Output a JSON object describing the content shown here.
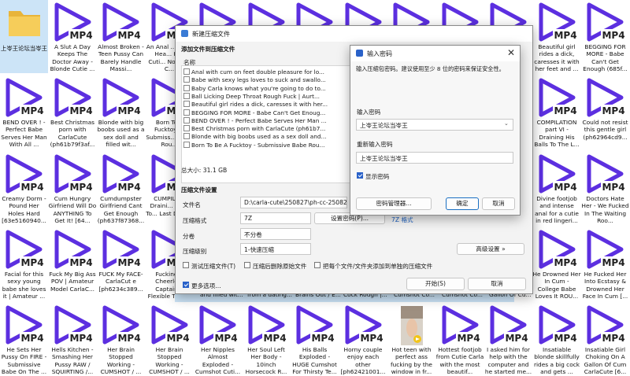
{
  "grid": {
    "tiles": [
      {
        "kind": "folder",
        "label": "上岺王论坛当岺王",
        "selected": true
      },
      {
        "kind": "mp4",
        "label": "A Slut A Day Keeps The Doctor Away - Blonde Cutie ..."
      },
      {
        "kind": "mp4",
        "label": "Almost Broken - Teen Pussy Can Barely Handle Massi..."
      },
      {
        "kind": "mp4",
        "label": "An Anal ... From Hea... Her Cuti... Not The C..."
      },
      {
        "kind": "mp4",
        "label": ""
      },
      {
        "kind": "mp4",
        "label": ""
      },
      {
        "kind": "mp4",
        "label": ""
      },
      {
        "kind": "mp4",
        "label": ""
      },
      {
        "kind": "mp4",
        "label": ""
      },
      {
        "kind": "mp4",
        "label": ""
      },
      {
        "kind": "mp4",
        "label": ""
      },
      {
        "kind": "mp4",
        "label": "Beautiful girl rides a dick, caresses it with her feet and ..."
      },
      {
        "kind": "mp4",
        "label": "BEGGING FOR MORE - Babe Can't Get Enough (685f..."
      },
      {
        "kind": "mp4",
        "label": "BEND OVER ! - Perfect Babe Serves Her Man With All ..."
      },
      {
        "kind": "mp4",
        "label": "Best Christmas porn with CarlaCute (ph61b79f3af..."
      },
      {
        "kind": "mp4",
        "label": "Blonde with big boobs used as a sex doll and filled wit..."
      },
      {
        "kind": "mp4",
        "label": "Born To... Fucktoy ... Submiss... Babe Rou..."
      },
      {
        "kind": "mp4",
        "label": ""
      },
      {
        "kind": "mp4",
        "label": ""
      },
      {
        "kind": "mp4",
        "label": ""
      },
      {
        "kind": "mp4",
        "label": ""
      },
      {
        "kind": "mp4",
        "label": ""
      },
      {
        "kind": "mp4",
        "label": ""
      },
      {
        "kind": "mp4",
        "label": ""
      },
      {
        "kind": "mp4",
        "label": "COMPILATION part VI - Draining His Balls To The L..."
      },
      {
        "kind": "mp4",
        "label": "Could not resist this gentle girl (ph62964cd9..."
      },
      {
        "kind": "mp4",
        "label": "Creamy Dorm - Pound Her Holes Hard [63e5160940..."
      },
      {
        "kind": "mp4",
        "label": "Cum Hungry Girfriend Will Do ANYTHING To Get It! [64..."
      },
      {
        "kind": "mp4",
        "label": "Cumdumpster Girlfriend Cant Get Enough (ph637f87368..."
      },
      {
        "kind": "mp4",
        "label": "CUMPILA... Draini... Balls To... Last Drop..."
      },
      {
        "kind": "mp4",
        "label": ""
      },
      {
        "kind": "mp4",
        "label": ""
      },
      {
        "kind": "mp4",
        "label": ""
      },
      {
        "kind": "mp4",
        "label": ""
      },
      {
        "kind": "mp4",
        "label": ""
      },
      {
        "kind": "mp4",
        "label": ""
      },
      {
        "kind": "mp4",
        "label": ""
      },
      {
        "kind": "mp4",
        "label": "Divine footjob and intense anal for a cutie in red lingeri..."
      },
      {
        "kind": "mp4",
        "label": "Doctors Hate Her - We Fucked In The Waiting Roo..."
      },
      {
        "kind": "mp4",
        "label": "Facial for this sexy young babe she loves it | Amateur ..."
      },
      {
        "kind": "mp4",
        "label": "Fuck My Big Ass POV | Amateur Model CarlaC..."
      },
      {
        "kind": "mp4",
        "label": "FUCK My FACE-CarlaCut e [ph6234c389..."
      },
      {
        "kind": "mp4",
        "label": "Fucking... Cheerle... Captain... Flexible Teen..."
      },
      {
        "kind": "mp4",
        "label": ""
      },
      {
        "kind": "mp4",
        "label": ""
      },
      {
        "kind": "mp4",
        "label": ""
      },
      {
        "kind": "mp4",
        "label": ""
      },
      {
        "kind": "mp4",
        "label": ""
      },
      {
        "kind": "mp4",
        "label": ""
      },
      {
        "kind": "mp4",
        "label": ""
      },
      {
        "kind": "mp4",
        "label": "He Drowned Her In Cum - College Babe Loves It ROU..."
      },
      {
        "kind": "mp4",
        "label": "He Fucked Her Into Ecstasy & Drowned Her Face In Cum [..."
      },
      {
        "kind": "mp4",
        "label": "He Sets Her Pussy On FIRE - Submissive Babe On The ..."
      },
      {
        "kind": "mp4",
        "label": "Hells Kitchen - Smashing Her Pussy RAW / SQUIRTING /..."
      },
      {
        "kind": "mp4",
        "label": "Her Brain Stopped Working - CUMSHOT / ..."
      },
      {
        "kind": "mp4",
        "label": "Her Brain Stopped Working - CUMSHOT / ..."
      },
      {
        "kind": "mp4",
        "label": "Her Nipples Almost Exploded - Cumshot Cuti..."
      },
      {
        "kind": "mp4",
        "label": "Her Soul Left Her Body - 10inch Horsecock R..."
      },
      {
        "kind": "mp4",
        "label": "His Balls Exploded - HUGE Cumshot For Thirsty Te..."
      },
      {
        "kind": "mp4",
        "label": "Horny couple enjoy each other [ph62421001..."
      },
      {
        "kind": "thumb",
        "label": "Hot teen with perfect ass fucking by the window in fr..."
      },
      {
        "kind": "mp4",
        "label": "Hottest footjob from Cutie Carla with the most beautif..."
      },
      {
        "kind": "mp4",
        "label": "I asked him for help with the computer and he started me..."
      },
      {
        "kind": "mp4",
        "label": "Insatiable blonde skillfully rides a big cock and gets ..."
      },
      {
        "kind": "mp4",
        "label": "Insatiable Girl Choking On A Gallon Of Cum CarlaCute [6..."
      }
    ],
    "strip_labels": [
      "and filled wit...",
      "from a dating...",
      "Brains Out / E...",
      "Cock Rough |...",
      "Cumshot Co...",
      "Cumshot Co...",
      "Gallon Of Cu..."
    ],
    "mp4_badge": "MP4"
  },
  "archive_dialog": {
    "title": "新建压缩文件",
    "section_add": "添加文件到压缩文件",
    "list_header": "名称",
    "files": [
      {
        "name": "Anal with cum on feet double pleasure for lo...",
        "size": "274"
      },
      {
        "name": "Babe with sexy legs loves to suck and swallo...",
        "size": "174"
      },
      {
        "name": "Baby Carla knows what you're going to do to...",
        "size": "252"
      },
      {
        "name": "Ball Licking Deep Throat Rough Fuck | Aurt...",
        "size": "251"
      },
      {
        "name": "Beautiful girl rides a dick, caresses it with her...",
        "size": "345"
      },
      {
        "name": "BEGGING FOR MORE - Babe Can't Get Enoug...",
        "size": "465"
      },
      {
        "name": "BEND OVER ! - Perfect Babe Serves Her Man ...",
        "size": "350"
      },
      {
        "name": "Best Christmas porn with CarlaCute (ph61b7...",
        "size": "531"
      },
      {
        "name": "Blonde with big boobs used as a sex doll and...",
        "size": "195"
      },
      {
        "name": "Born To Be A Fucktoy - Submissive Babe Rou...",
        "size": "232"
      }
    ],
    "total": "总大小: 31.1 GB",
    "section_settings": "压缩文件设置",
    "filename_label": "文件名",
    "filename_value": "D:\\carla-cute\\250827\\ph-cc-250827.7z",
    "format_label": "压缩格式",
    "format_value": "7Z",
    "set_password_button": "设置密码(P)...",
    "format_link": "7Z 格式",
    "split_label": "分卷",
    "split_value": "不分卷",
    "level_label": "压缩级别",
    "level_value": "1-快速压缩",
    "advanced_button": "高级设置 »",
    "opt_test": "测试压缩文件(T)",
    "opt_delete": "压缩后删除原始文件",
    "opt_separate": "把每个文件/文件夹添加到单独的压缩文件",
    "more_options": "更多选项...",
    "start_button": "开始(S)",
    "cancel_button": "取消"
  },
  "password_dialog": {
    "title": "输入密码",
    "hint": "输入压缩包密码。建议使用至少 8 位的密码来保证安全性。",
    "password_label": "输入密码",
    "password_value": "上岺王论坛当岺王",
    "confirm_label": "重新输入密码",
    "confirm_value": "上岺王论坛当岺王",
    "show_password": "显示密码",
    "manager_button": "密码管理器...",
    "ok_button": "确定",
    "cancel_button": "取消"
  },
  "colors": {
    "mp4_purple": "#5c2fe0",
    "selection": "#cce4f7",
    "accent": "#2a62c9"
  }
}
